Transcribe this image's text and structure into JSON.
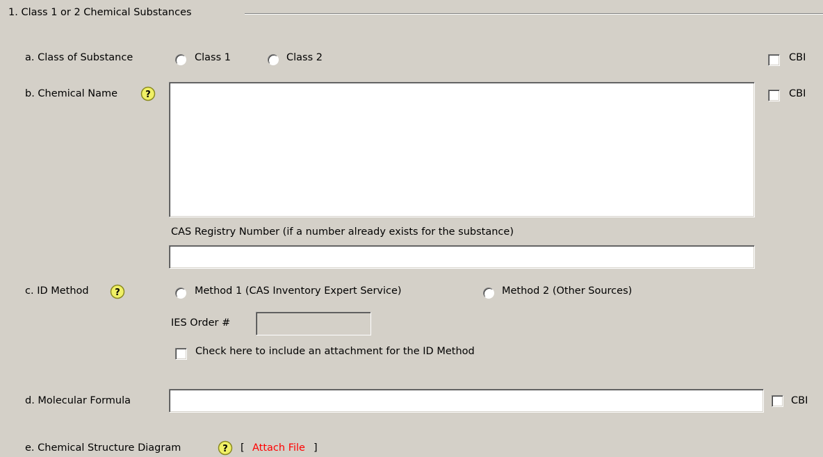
{
  "section": {
    "title": "1.  Class 1 or 2 Chemical Substances"
  },
  "class_of_substance": {
    "label": "a. Class of Substance",
    "option1": "Class 1",
    "option2": "Class 2",
    "cbi_label": "CBI"
  },
  "chemical_name": {
    "label": "b. Chemical Name",
    "value": "",
    "cbi_label": "CBI"
  },
  "cas_registry": {
    "label": "CAS Registry Number (if a number already exists for the substance)",
    "value": ""
  },
  "id_method": {
    "label": "c. ID Method",
    "option1": "Method 1 (CAS Inventory Expert Service)",
    "option2": "Method 2 (Other Sources)",
    "ies_order_label": "IES Order #",
    "ies_order_value": "",
    "attachment_check_label": "Check here to include an attachment for the ID Method"
  },
  "molecular_formula": {
    "label": "d. Molecular Formula",
    "value": "",
    "cbi_label": "CBI"
  },
  "structure_diagram": {
    "label": "e. Chemical Structure Diagram",
    "bracket_open": "[",
    "attach_label": "Attach File",
    "bracket_close": "]"
  },
  "colors": {
    "background": "#d4d0c8",
    "help_icon": "#f0f066",
    "link": "#ff0000"
  }
}
